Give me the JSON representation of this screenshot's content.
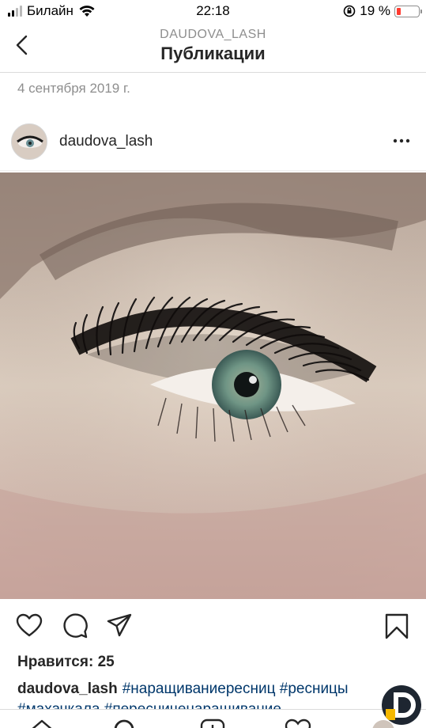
{
  "status_bar": {
    "carrier": "Билайн",
    "time": "22:18",
    "battery_percent": "19 %",
    "battery_level": 0.19,
    "icons": [
      "cellular-signal-icon",
      "wifi-icon",
      "orientation-lock-icon",
      "battery-icon"
    ]
  },
  "nav": {
    "subtitle": "DAUDOVA_LASH",
    "title": "Публикации",
    "back_icon": "chevron-left-icon"
  },
  "post": {
    "date": "4 сентября 2019 г.",
    "username": "daudova_lash",
    "more_icon": "more-horizontal-icon",
    "likes": "Нравится: 25",
    "caption": {
      "user": "daudova_lash",
      "hashtags_line1": "#наращиваниересниц #ресницы",
      "hashtags_line2": "#махачкала #пересниченаращивание"
    },
    "actions": [
      "heart-icon",
      "comment-icon",
      "share-icon",
      "bookmark-icon"
    ]
  },
  "tab_bar": [
    "home-icon",
    "search-icon",
    "add-post-icon",
    "activity-icon",
    "profile-icon"
  ],
  "colors": {
    "text": "#262626",
    "secondary": "#8e8e8e",
    "hashtag": "#00376b",
    "battery_low": "#ff3b30",
    "fab_bg": "#1e2631",
    "fab_accent": "#f5b800"
  }
}
